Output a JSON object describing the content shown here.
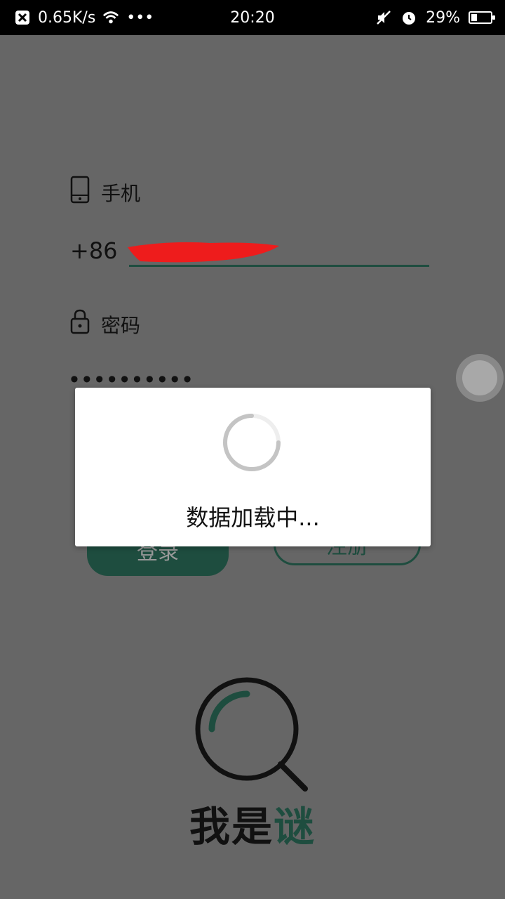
{
  "status_bar": {
    "net_speed": "0.65K/s",
    "more": "•••",
    "time": "20:20",
    "battery": "29%",
    "battery_level": 0.29
  },
  "form": {
    "phone_label": "手机",
    "country_code": "+86",
    "phone_value": "",
    "password_label": "密码",
    "password_value": "••••••••••"
  },
  "buttons": {
    "login": "登录",
    "register": "注册"
  },
  "dialog": {
    "loading_text": "数据加载中..."
  },
  "logo": {
    "text_main": "我是",
    "text_accent": "谜"
  },
  "colors": {
    "accent": "#1e4d3f",
    "scrim": "#666666"
  }
}
